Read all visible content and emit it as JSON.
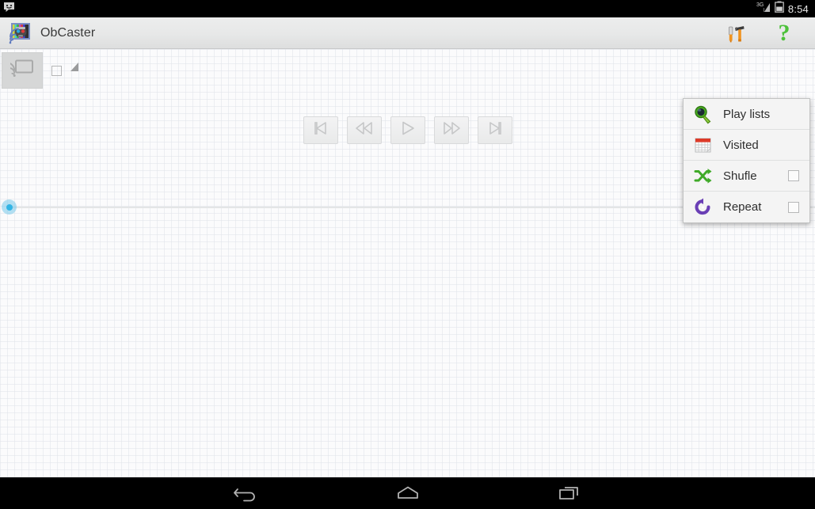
{
  "status_bar": {
    "notification_icon": "message-icon",
    "network_label": "3G",
    "signal_icon": "signal-bars-icon",
    "battery_icon": "battery-icon",
    "time": "8:54"
  },
  "action_bar": {
    "app_icon": "obcaster-app-icon",
    "title": "ObCaster",
    "actions": [
      {
        "name": "tools-icon",
        "label": "Tools"
      },
      {
        "name": "help-icon",
        "label": "?"
      }
    ]
  },
  "toolbar": {
    "cast_icon": "cast-icon",
    "checkbox_checked": false,
    "spinner_icon": "spinner-triangle-icon"
  },
  "transport": {
    "buttons": [
      {
        "name": "skip-previous-button",
        "glyph": "skip-previous-icon"
      },
      {
        "name": "rewind-button",
        "glyph": "rewind-icon"
      },
      {
        "name": "play-button",
        "glyph": "play-icon"
      },
      {
        "name": "fast-forward-button",
        "glyph": "fast-forward-icon"
      },
      {
        "name": "skip-next-button",
        "glyph": "skip-next-icon"
      }
    ]
  },
  "seekbar": {
    "name": "playback-seekbar",
    "value": 0,
    "min": 0,
    "max": 100,
    "thumb_color": "#33b5e5",
    "track_color": "#e3e5e6"
  },
  "popup_menu": {
    "items": [
      {
        "label": "Play lists",
        "icon": "magnifier-icon",
        "has_checkbox": false,
        "checked": false
      },
      {
        "label": "Visited",
        "icon": "calendar-icon",
        "has_checkbox": false,
        "checked": false
      },
      {
        "label": "Shufle",
        "icon": "shuffle-icon",
        "has_checkbox": true,
        "checked": false
      },
      {
        "label": "Repeat",
        "icon": "repeat-icon",
        "has_checkbox": true,
        "checked": false
      }
    ]
  },
  "nav_bar": {
    "buttons": [
      {
        "name": "nav-back-button",
        "label": "Back"
      },
      {
        "name": "nav-home-button",
        "label": "Home"
      },
      {
        "name": "nav-recents-button",
        "label": "Recents"
      }
    ]
  },
  "colors": {
    "accent": "#33b5e5",
    "help_green": "#4cc13a",
    "tools_orange": "#e8821e",
    "shuffle_green": "#3faa28",
    "repeat_purple": "#6a3fb5",
    "calendar_red": "#d93a2b",
    "action_bar_bg": "#e7e8e8",
    "content_bg": "#fbfbfc"
  }
}
